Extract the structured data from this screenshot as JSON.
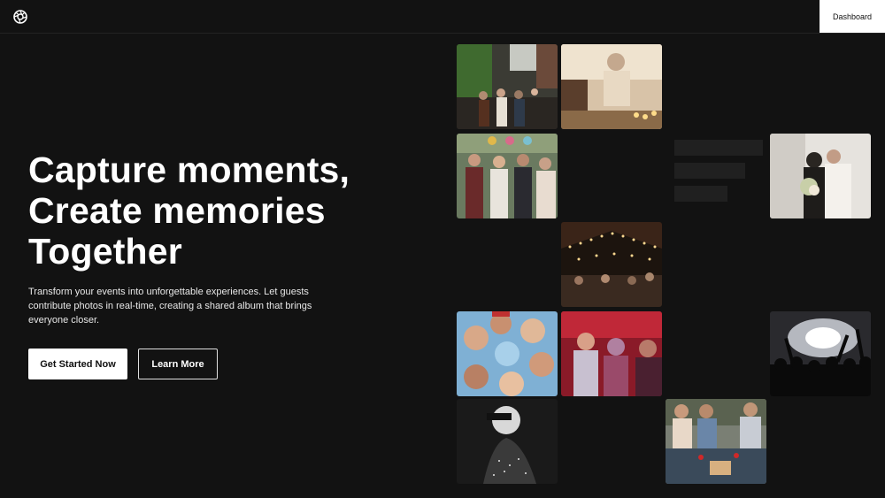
{
  "header": {
    "logo_icon": "aperture-icon",
    "dashboard_label": "Dashboard"
  },
  "hero": {
    "title_lines": [
      "Capture moments,",
      "Create memories",
      "Together"
    ],
    "subtitle": "Transform your events into unforgettable experiences. Let guests contribute photos in real-time, creating a shared album that brings everyone closer.",
    "primary_cta": "Get Started Now",
    "secondary_cta": "Learn More"
  },
  "gallery": {
    "photos": [
      {
        "name": "photo-street-crowd"
      },
      {
        "name": "photo-elderly-woman-candles"
      },
      {
        "name": "photo-birthday-party-toast"
      },
      {
        "name": "photo-wedding-couple"
      },
      {
        "name": "photo-string-lights-party"
      },
      {
        "name": "photo-friends-circle-selfie"
      },
      {
        "name": "photo-friends-red-light"
      },
      {
        "name": "photo-concert-crowd"
      },
      {
        "name": "photo-bw-portrait"
      },
      {
        "name": "photo-picnic-friends"
      }
    ]
  },
  "colors": {
    "background": "#121212",
    "button_bg": "#ffffff",
    "button_text": "#111111"
  }
}
